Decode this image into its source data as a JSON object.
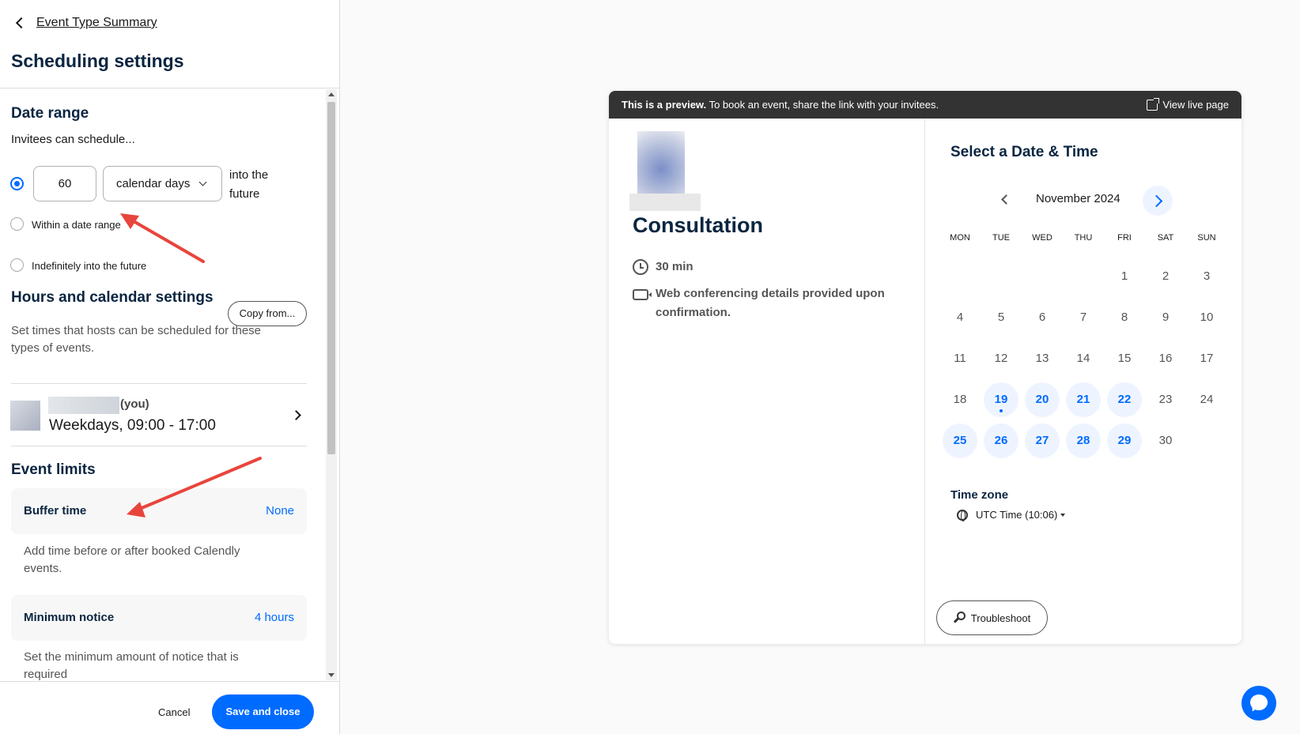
{
  "header": {
    "back_label": "Event Type Summary",
    "title": "Scheduling settings"
  },
  "date_range": {
    "title": "Date range",
    "subtitle": "Invitees can schedule...",
    "days_value": "60",
    "unit_selected": "calendar days",
    "into_future_line1": "into the",
    "into_future_line2": "future",
    "option_within": "Within a date range",
    "option_indefinite": "Indefinitely into the future"
  },
  "hours": {
    "title": "Hours and calendar settings",
    "copy_button": "Copy from...",
    "description_line1": "Set times that hosts can be scheduled for these",
    "description_line2": "types of events.",
    "host_you": "(you)",
    "host_hours": "Weekdays, 09:00 - 17:00"
  },
  "event_limits": {
    "title": "Event limits",
    "buffer_label": "Buffer time",
    "buffer_value": "None",
    "buffer_desc_line1": "Add time before or after booked Calendly",
    "buffer_desc_line2": "events.",
    "notice_label": "Minimum notice",
    "notice_value": "4 hours",
    "notice_desc_line1": "Set the minimum amount of notice that is",
    "notice_desc_line2": "required"
  },
  "footer": {
    "cancel": "Cancel",
    "save": "Save and close"
  },
  "preview": {
    "banner_bold": "This is a preview.",
    "banner_text": " To book an event, share the link with your invitees.",
    "view_live": "View live page",
    "event_title": "Consultation",
    "duration": "30 min",
    "conferencing_line1": "Web conferencing details provided upon",
    "conferencing_line2": "confirmation.",
    "calendar_title": "Select a Date & Time",
    "month": "November 2024",
    "weekdays": [
      "MON",
      "TUE",
      "WED",
      "THU",
      "FRI",
      "SAT",
      "SUN"
    ],
    "timezone_title": "Time zone",
    "timezone_value": "UTC Time (10:06)",
    "troubleshoot": "Troubleshoot"
  },
  "calendar_days": [
    {
      "d": "1",
      "col": 4,
      "row": 0,
      "avail": false
    },
    {
      "d": "2",
      "col": 5,
      "row": 0,
      "avail": false
    },
    {
      "d": "3",
      "col": 6,
      "row": 0,
      "avail": false
    },
    {
      "d": "4",
      "col": 0,
      "row": 1,
      "avail": false
    },
    {
      "d": "5",
      "col": 1,
      "row": 1,
      "avail": false
    },
    {
      "d": "6",
      "col": 2,
      "row": 1,
      "avail": false
    },
    {
      "d": "7",
      "col": 3,
      "row": 1,
      "avail": false
    },
    {
      "d": "8",
      "col": 4,
      "row": 1,
      "avail": false
    },
    {
      "d": "9",
      "col": 5,
      "row": 1,
      "avail": false
    },
    {
      "d": "10",
      "col": 6,
      "row": 1,
      "avail": false
    },
    {
      "d": "11",
      "col": 0,
      "row": 2,
      "avail": false
    },
    {
      "d": "12",
      "col": 1,
      "row": 2,
      "avail": false
    },
    {
      "d": "13",
      "col": 2,
      "row": 2,
      "avail": false
    },
    {
      "d": "14",
      "col": 3,
      "row": 2,
      "avail": false
    },
    {
      "d": "15",
      "col": 4,
      "row": 2,
      "avail": false
    },
    {
      "d": "16",
      "col": 5,
      "row": 2,
      "avail": false
    },
    {
      "d": "17",
      "col": 6,
      "row": 2,
      "avail": false
    },
    {
      "d": "18",
      "col": 0,
      "row": 3,
      "avail": false
    },
    {
      "d": "19",
      "col": 1,
      "row": 3,
      "avail": true,
      "today": true
    },
    {
      "d": "20",
      "col": 2,
      "row": 3,
      "avail": true
    },
    {
      "d": "21",
      "col": 3,
      "row": 3,
      "avail": true
    },
    {
      "d": "22",
      "col": 4,
      "row": 3,
      "avail": true
    },
    {
      "d": "23",
      "col": 5,
      "row": 3,
      "avail": false
    },
    {
      "d": "24",
      "col": 6,
      "row": 3,
      "avail": false
    },
    {
      "d": "25",
      "col": 0,
      "row": 4,
      "avail": true
    },
    {
      "d": "26",
      "col": 1,
      "row": 4,
      "avail": true
    },
    {
      "d": "27",
      "col": 2,
      "row": 4,
      "avail": true
    },
    {
      "d": "28",
      "col": 3,
      "row": 4,
      "avail": true
    },
    {
      "d": "29",
      "col": 4,
      "row": 4,
      "avail": true
    },
    {
      "d": "30",
      "col": 5,
      "row": 4,
      "avail": false
    }
  ],
  "colors": {
    "accent": "#006bff",
    "available_bg": "#eef4ff",
    "banner_bg": "#333333",
    "annotation_arrow": "#e8453c"
  }
}
